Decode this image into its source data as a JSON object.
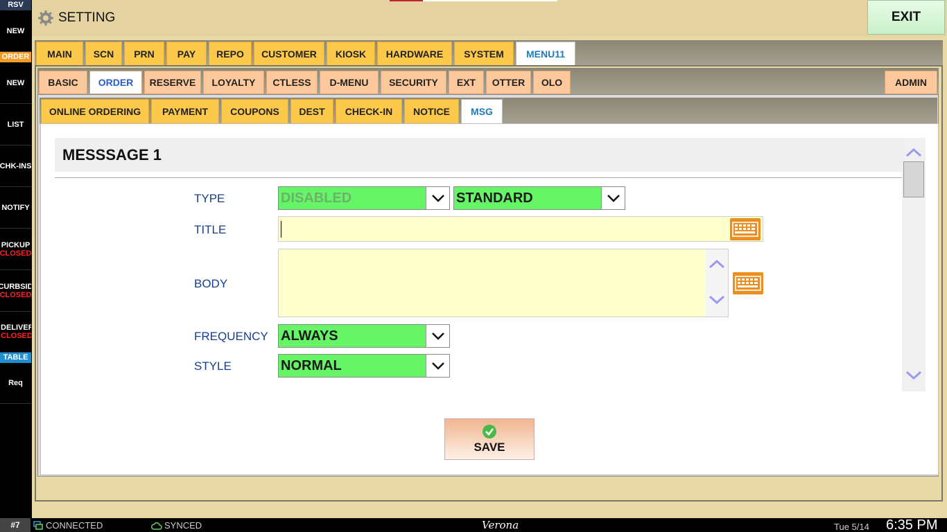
{
  "sidebar": {
    "rsv_header": "RSV",
    "order_header": "ORDER",
    "table_header": "TABLE",
    "items": [
      {
        "label": "NEW",
        "status": ""
      },
      {
        "label": "NEW",
        "status": ""
      },
      {
        "label": "LIST",
        "status": ""
      },
      {
        "label": "CHK-INS",
        "status": ""
      },
      {
        "label": "NOTIFY",
        "status": ""
      },
      {
        "label": "PICKUP",
        "status": "CLOSED"
      },
      {
        "label": "CURBSID",
        "status": "CLOSED"
      },
      {
        "label": "DELIVERY",
        "status": "CLOSED"
      },
      {
        "label": "Req",
        "status": ""
      }
    ],
    "colors": {
      "order": "#f39c25",
      "table": "#1e8fd0",
      "closed": "#ff2222"
    }
  },
  "header": {
    "title": "SETTING",
    "exit_label": "EXIT",
    "progress_fraction": 0.2
  },
  "tabs_level1": [
    "MAIN",
    "SCN",
    "PRN",
    "PAY",
    "REPO",
    "CUSTOMER",
    "KIOSK",
    "HARDWARE",
    "SYSTEM",
    "MENU11"
  ],
  "tabs_level1_active": "MENU11",
  "tabs_level2": [
    "BASIC",
    "ORDER",
    "RESERVE",
    "LOYALTY",
    "CTLESS",
    "D-MENU",
    "SECURITY",
    "EXT",
    "OTTER",
    "OLO"
  ],
  "tabs_level2_active": "ORDER",
  "tabs_level2_admin": "ADMIN",
  "tabs_level3": [
    "ONLINE ORDERING",
    "PAYMENT",
    "COUPONS",
    "DEST",
    "CHECK-IN",
    "NOTICE",
    "MSG"
  ],
  "tabs_level3_active": "MSG",
  "form": {
    "section_title": "MESSSAGE 1",
    "type_label": "TYPE",
    "type_value1": "DISABLED",
    "type_value2": "STANDARD",
    "title_label": "TITLE",
    "title_value": "",
    "body_label": "BODY",
    "body_value": "",
    "frequency_label": "FREQUENCY",
    "frequency_value": "ALWAYS",
    "style_label": "STYLE",
    "style_value": "NORMAL",
    "save_label": "SAVE"
  },
  "status_bar": {
    "station": "#7",
    "connected": "CONNECTED",
    "synced": "SYNCED",
    "store_name": "Verona",
    "date": "Tue 5/14",
    "time": "6:35 PM"
  }
}
